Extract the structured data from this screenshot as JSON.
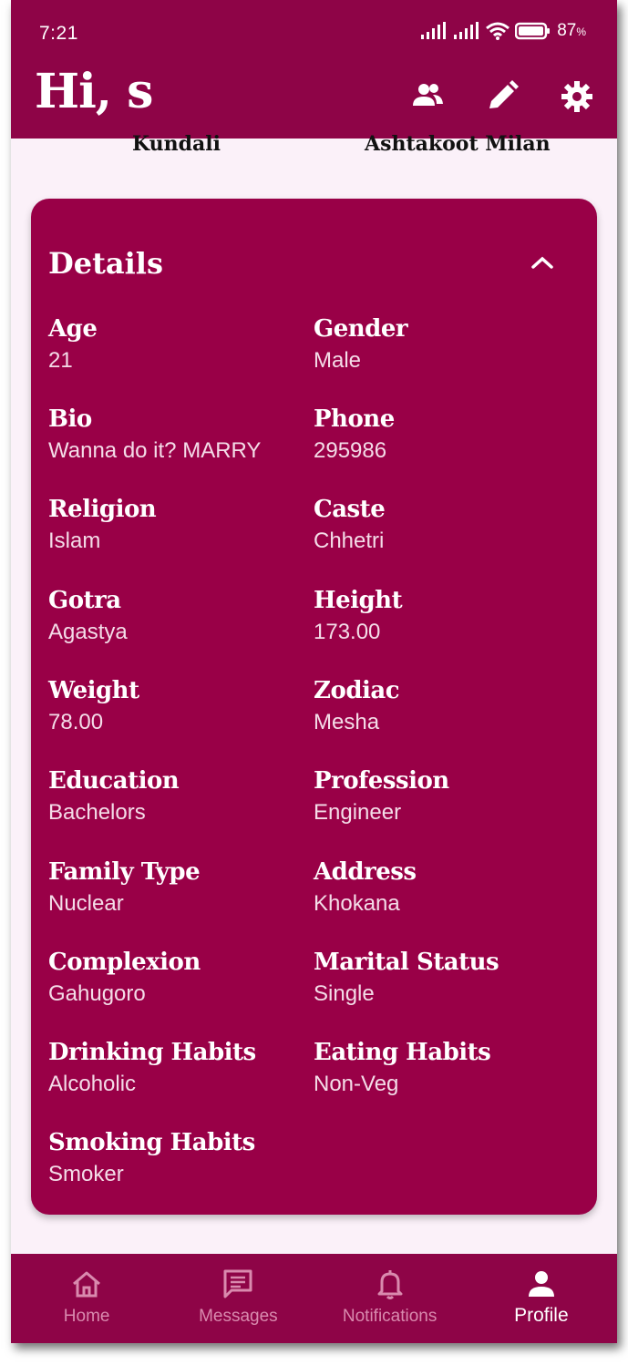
{
  "status_bar": {
    "time": "7:21",
    "battery": "87",
    "battery_unit": "%"
  },
  "header": {
    "greeting": "Hi, s"
  },
  "top_tabs": {
    "left": "Kundali",
    "right": "Ashtakoot Milan"
  },
  "details": {
    "title": "Details",
    "fields": [
      {
        "label": "Age",
        "value": "21"
      },
      {
        "label": "Gender",
        "value": "Male"
      },
      {
        "label": "Bio",
        "value": "Wanna do it? MARRY"
      },
      {
        "label": "Phone",
        "value": "295986"
      },
      {
        "label": "Religion",
        "value": "Islam"
      },
      {
        "label": "Caste",
        "value": "Chhetri"
      },
      {
        "label": "Gotra",
        "value": "Agastya"
      },
      {
        "label": "Height",
        "value": "173.00"
      },
      {
        "label": "Weight",
        "value": "78.00"
      },
      {
        "label": "Zodiac",
        "value": "Mesha"
      },
      {
        "label": "Education",
        "value": "Bachelors"
      },
      {
        "label": "Profession",
        "value": "Engineer"
      },
      {
        "label": "Family Type",
        "value": "Nuclear"
      },
      {
        "label": "Address",
        "value": "Khokana"
      },
      {
        "label": "Complexion",
        "value": "Gahugoro"
      },
      {
        "label": "Marital Status",
        "value": "Single"
      },
      {
        "label": "Drinking Habits",
        "value": "Alcoholic"
      },
      {
        "label": "Eating Habits",
        "value": "Non-Veg"
      },
      {
        "label": "Smoking Habits",
        "value": "Smoker"
      }
    ]
  },
  "nav": {
    "home": "Home",
    "messages": "Messages",
    "notifications": "Notifications",
    "profile": "Profile",
    "active": "profile"
  },
  "icons": {
    "friends": "people-icon",
    "edit": "pencil-icon",
    "settings": "gear-icon",
    "collapse": "chevron-up-icon"
  },
  "colors": {
    "primary": "#8E0447",
    "card": "#990047",
    "background": "#FBF1F9"
  }
}
